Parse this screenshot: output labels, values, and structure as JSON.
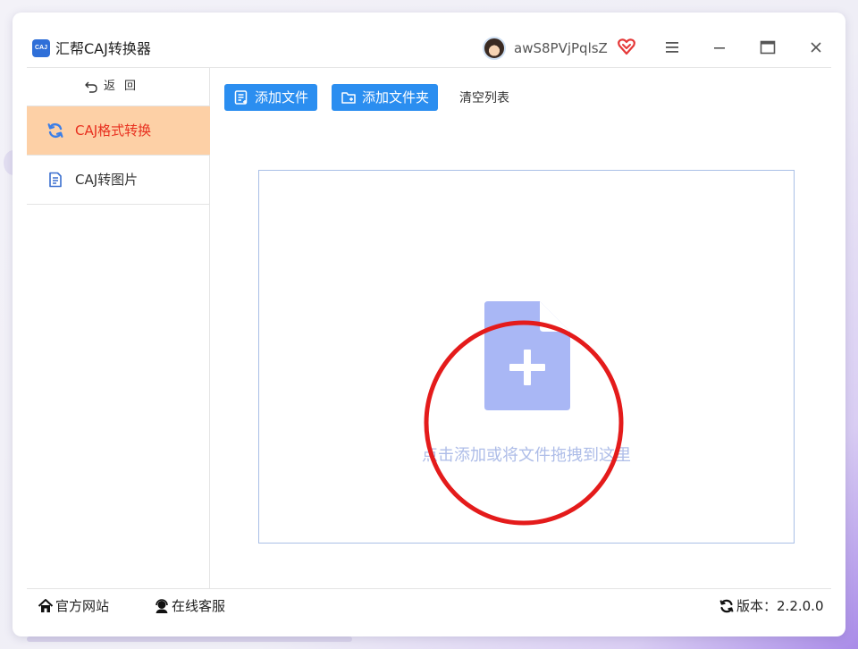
{
  "app": {
    "logo_text": "CAJ",
    "title": "汇帮CAJ转换器"
  },
  "user": {
    "name": "awS8PVjPqlsZ"
  },
  "colors": {
    "accent": "#2b8ef0",
    "active_bg": "#fdd0a6",
    "active_text": "#e8301f",
    "annotation": "#e41b1b",
    "drop_icon": "#a9b7f5"
  },
  "sidebar": {
    "back_label": "返回",
    "items": [
      {
        "label": "CAJ格式转换",
        "icon": "refresh-icon",
        "active": true
      },
      {
        "label": "CAJ转图片",
        "icon": "document-icon",
        "active": false
      }
    ]
  },
  "toolbar": {
    "add_file": "添加文件",
    "add_folder": "添加文件夹",
    "clear_list": "清空列表"
  },
  "dropzone": {
    "hint": "点击添加或将文件拖拽到这里"
  },
  "footer": {
    "website": "官方网站",
    "service": "在线客服",
    "version_label": "版本：",
    "version": "2.2.0.0"
  }
}
